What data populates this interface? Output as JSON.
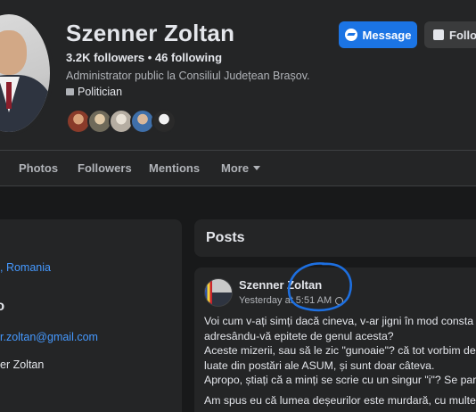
{
  "profile": {
    "name": "Szenner Zoltan",
    "stats": "3.2K followers • 46 following",
    "bio": "Administrator public la Consiliul Județean Brașov.",
    "category": "Politician"
  },
  "buttons": {
    "message": "Message",
    "follow": "Follo"
  },
  "tabs": [
    {
      "label": "Photos"
    },
    {
      "label": "Followers"
    },
    {
      "label": "Mentions"
    },
    {
      "label": "More"
    }
  ],
  "left_card": {
    "location": ", Romania",
    "heading": "fo",
    "email": "r.zoltan@gmail.com",
    "name": "er Zoltan"
  },
  "posts": {
    "title": "Posts",
    "post": {
      "author": "Szenner Zoltan",
      "time": "Yesterday at 5:51 AM",
      "lines": [
        "Voi cum v-ați simți dacă cineva, v-ar jigni în mod consta",
        "adresându-vă epitete de genul acesta?",
        "Aceste mizerii, sau să le zic \"gunoaie\"? că tot vorbim de",
        "luate din postări ale ASUM,  și sunt doar câteva.",
        "Apropo, știați că a minți se scrie cu un singur \"i\"? Se par"
      ],
      "line2": "Am spus eu că lumea deșeurilor este murdară, cu multe"
    }
  },
  "colors": {
    "background": "#18191a",
    "card": "#242526",
    "accent": "#1b74e4",
    "link": "#4599ff",
    "annotation": "#1d6fe0"
  }
}
